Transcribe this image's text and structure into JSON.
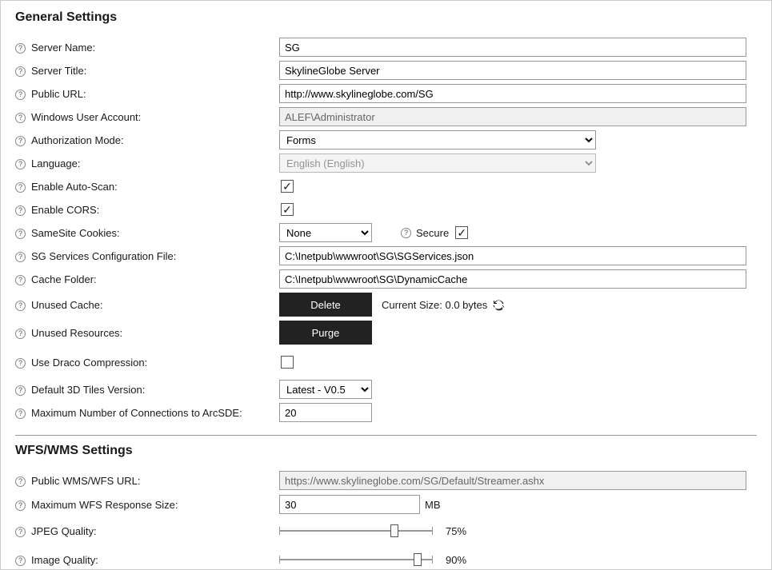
{
  "general": {
    "title": "General Settings",
    "serverName": {
      "label": "Server Name:",
      "value": "SG"
    },
    "serverTitle": {
      "label": "Server Title:",
      "value": "SkylineGlobe Server"
    },
    "publicUrl": {
      "label": "Public URL:",
      "value": "http://www.skylineglobe.com/SG"
    },
    "winUser": {
      "label": "Windows User Account:",
      "value": "ALEF\\Administrator"
    },
    "authMode": {
      "label": "Authorization Mode:",
      "value": "Forms"
    },
    "language": {
      "label": "Language:",
      "value": "English (English)"
    },
    "autoScan": {
      "label": "Enable Auto-Scan:",
      "checked": true
    },
    "cors": {
      "label": "Enable CORS:",
      "checked": true
    },
    "sameSite": {
      "label": "SameSite Cookies:",
      "value": "None",
      "secureLabel": "Secure",
      "secureChecked": true
    },
    "sgServicesFile": {
      "label": "SG Services Configuration File:",
      "value": "C:\\Inetpub\\wwwroot\\SG\\SGServices.json"
    },
    "cacheFolder": {
      "label": "Cache Folder:",
      "value": "C:\\Inetpub\\wwwroot\\SG\\DynamicCache"
    },
    "unusedCache": {
      "label": "Unused Cache:",
      "action": "Delete",
      "sizeText": "Current Size: 0.0 bytes"
    },
    "unusedResources": {
      "label": "Unused Resources:",
      "action": "Purge"
    },
    "draco": {
      "label": "Use Draco Compression:",
      "checked": false
    },
    "tiles3d": {
      "label": "Default 3D Tiles Version:",
      "value": "Latest - V0.5"
    },
    "arcSdeMax": {
      "label": "Maximum Number of Connections to ArcSDE:",
      "value": "20"
    }
  },
  "wfswms": {
    "title": "WFS/WMS Settings",
    "publicUrl": {
      "label": "Public WMS/WFS URL:",
      "value": "https://www.skylineglobe.com/SG/Default/Streamer.ashx"
    },
    "maxResp": {
      "label": "Maximum WFS Response Size:",
      "value": "30",
      "suffix": "MB"
    },
    "jpegQuality": {
      "label": "JPEG Quality:",
      "percent": 75,
      "percentText": "75%"
    },
    "imageQuality": {
      "label": "Image Quality:",
      "percent": 90,
      "percentText": "90%"
    }
  }
}
